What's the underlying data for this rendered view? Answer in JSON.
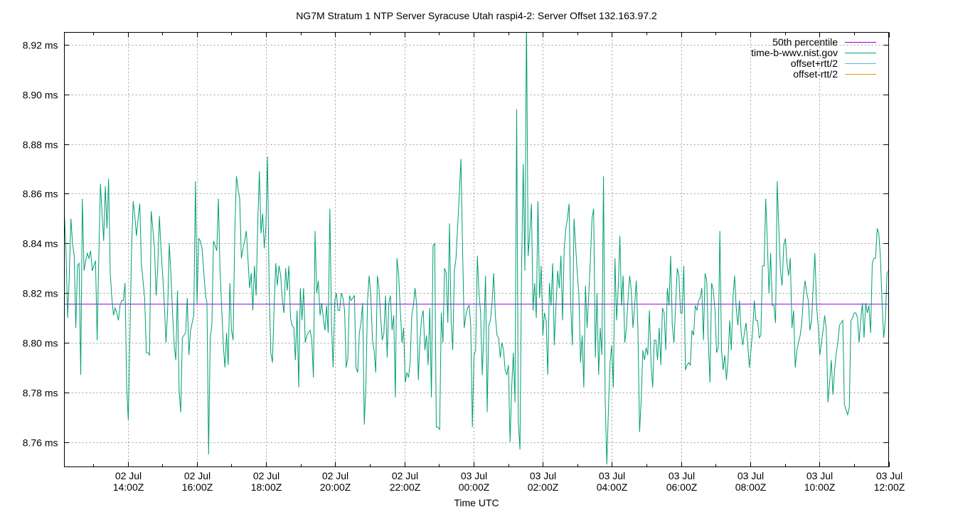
{
  "chart_data": {
    "type": "line",
    "title": "NG7M Stratum 1 NTP Server Syracuse Utah raspi4-2: Server Offset 132.163.97.2",
    "xlabel": "Time UTC",
    "ylabel": "",
    "ylim": [
      8.75,
      8.925
    ],
    "yticks": [
      {
        "value": 8.76,
        "label": "8.76 ms"
      },
      {
        "value": 8.78,
        "label": "8.78 ms"
      },
      {
        "value": 8.8,
        "label": "8.80 ms"
      },
      {
        "value": 8.82,
        "label": "8.82 ms"
      },
      {
        "value": 8.84,
        "label": "8.84 ms"
      },
      {
        "value": 8.86,
        "label": "8.86 ms"
      },
      {
        "value": 8.88,
        "label": "8.88 ms"
      },
      {
        "value": 8.9,
        "label": "8.90 ms"
      },
      {
        "value": 8.92,
        "label": "8.92 ms"
      }
    ],
    "xlim_hours": [
      12.17,
      36.0
    ],
    "xticks": [
      {
        "hours": 14,
        "line1": "02 Jul",
        "line2": "14:00Z"
      },
      {
        "hours": 16,
        "line1": "02 Jul",
        "line2": "16:00Z"
      },
      {
        "hours": 18,
        "line1": "02 Jul",
        "line2": "18:00Z"
      },
      {
        "hours": 20,
        "line1": "02 Jul",
        "line2": "20:00Z"
      },
      {
        "hours": 22,
        "line1": "02 Jul",
        "line2": "22:00Z"
      },
      {
        "hours": 24,
        "line1": "03 Jul",
        "line2": "00:00Z"
      },
      {
        "hours": 26,
        "line1": "03 Jul",
        "line2": "02:00Z"
      },
      {
        "hours": 28,
        "line1": "03 Jul",
        "line2": "04:00Z"
      },
      {
        "hours": 30,
        "line1": "03 Jul",
        "line2": "06:00Z"
      },
      {
        "hours": 32,
        "line1": "03 Jul",
        "line2": "08:00Z"
      },
      {
        "hours": 34,
        "line1": "03 Jul",
        "line2": "10:00Z"
      },
      {
        "hours": 36,
        "line1": "03 Jul",
        "line2": "12:00Z"
      }
    ],
    "grid": true,
    "legend_position": "top-right",
    "series": [
      {
        "name": "50th percentile",
        "color": "#9400d3",
        "kind": "hline",
        "value": 8.8155
      },
      {
        "name": "time-b-wwv.nist.gov",
        "color": "#009e73",
        "kind": "line",
        "values": [
          8.852,
          8.837,
          8.81,
          8.827,
          8.85,
          8.84,
          8.835,
          8.806,
          8.831,
          8.832,
          8.787,
          8.858,
          8.829,
          8.833,
          8.836,
          8.834,
          8.837,
          8.829,
          8.831,
          8.833,
          8.801,
          8.834,
          8.864,
          8.852,
          8.841,
          8.863,
          8.846,
          8.866,
          8.828,
          8.818,
          8.811,
          8.814,
          8.812,
          8.809,
          8.815,
          8.817,
          8.817,
          8.824,
          8.782,
          8.769,
          8.803,
          8.838,
          8.857,
          8.851,
          8.843,
          8.85,
          8.856,
          8.832,
          8.825,
          8.818,
          8.796,
          8.796,
          8.795,
          8.853,
          8.846,
          8.838,
          8.819,
          8.83,
          8.851,
          8.838,
          8.827,
          8.815,
          8.8,
          8.813,
          8.84,
          8.828,
          8.812,
          8.799,
          8.793,
          8.821,
          8.781,
          8.772,
          8.802,
          8.803,
          8.804,
          8.818,
          8.795,
          8.805,
          8.808,
          8.811,
          8.865,
          8.816,
          8.842,
          8.841,
          8.838,
          8.829,
          8.82,
          8.816,
          8.755,
          8.802,
          8.807,
          8.841,
          8.839,
          8.837,
          8.858,
          8.829,
          8.814,
          8.799,
          8.79,
          8.804,
          8.791,
          8.824,
          8.805,
          8.801,
          8.844,
          8.867,
          8.862,
          8.858,
          8.834,
          8.838,
          8.841,
          8.845,
          8.834,
          8.822,
          8.828,
          8.813,
          8.831,
          8.819,
          8.848,
          8.869,
          8.844,
          8.852,
          8.838,
          8.847,
          8.875,
          8.821,
          8.796,
          8.792,
          8.814,
          8.832,
          8.823,
          8.831,
          8.827,
          8.817,
          8.812,
          8.83,
          8.821,
          8.831,
          8.81,
          8.807,
          8.806,
          8.793,
          8.813,
          8.782,
          8.822,
          8.809,
          8.822,
          8.8,
          8.803,
          8.804,
          8.805,
          8.801,
          8.786,
          8.845,
          8.82,
          8.825,
          8.811,
          8.816,
          8.81,
          8.805,
          8.815,
          8.804,
          8.854,
          8.808,
          8.79,
          8.817,
          8.82,
          8.813,
          8.813,
          8.82,
          8.818,
          8.813,
          8.79,
          8.794,
          8.819,
          8.817,
          8.818,
          8.819,
          8.79,
          8.788,
          8.804,
          8.808,
          8.816,
          8.767,
          8.783,
          8.817,
          8.827,
          8.819,
          8.801,
          8.797,
          8.788,
          8.827,
          8.822,
          8.81,
          8.801,
          8.804,
          8.819,
          8.794,
          8.816,
          8.819,
          8.805,
          8.811,
          8.778,
          8.834,
          8.827,
          8.813,
          8.8,
          8.806,
          8.784,
          8.788,
          8.786,
          8.792,
          8.811,
          8.815,
          8.822,
          8.815,
          8.785,
          8.801,
          8.81,
          8.813,
          8.797,
          8.803,
          8.791,
          8.814,
          8.778,
          8.839,
          8.84,
          8.766,
          8.766,
          8.765,
          8.812,
          8.8,
          8.83,
          8.828,
          8.808,
          8.848,
          8.809,
          8.797,
          8.829,
          8.834,
          8.847,
          8.86,
          8.874,
          8.838,
          8.806,
          8.811,
          8.814,
          8.815,
          8.807,
          8.766,
          8.795,
          8.797,
          8.835,
          8.82,
          8.812,
          8.787,
          8.805,
          8.827,
          8.772,
          8.807,
          8.809,
          8.816,
          8.828,
          8.811,
          8.803,
          8.802,
          8.794,
          8.8,
          8.797,
          8.789,
          8.787,
          8.791,
          8.76,
          8.782,
          8.796,
          8.776,
          8.894,
          8.768,
          8.757,
          8.83,
          8.872,
          8.829,
          8.931,
          8.835,
          8.844,
          8.856,
          8.813,
          8.824,
          8.81,
          8.857,
          8.818,
          8.831,
          8.803,
          8.812,
          8.809,
          8.787,
          8.824,
          8.815,
          8.832,
          8.799,
          8.815,
          8.829,
          8.822,
          8.835,
          8.809,
          8.838,
          8.846,
          8.85,
          8.856,
          8.815,
          8.799,
          8.85,
          8.839,
          8.828,
          8.819,
          8.792,
          8.803,
          8.782,
          8.823,
          8.806,
          8.819,
          8.833,
          8.85,
          8.854,
          8.794,
          8.82,
          8.787,
          8.806,
          8.795,
          8.867,
          8.777,
          8.751,
          8.773,
          8.792,
          8.799,
          8.782,
          8.834,
          8.809,
          8.822,
          8.843,
          8.815,
          8.827,
          8.8,
          8.806,
          8.818,
          8.827,
          8.821,
          8.806,
          8.815,
          8.825,
          8.805,
          8.764,
          8.777,
          8.797,
          8.793,
          8.798,
          8.795,
          8.813,
          8.792,
          8.782,
          8.801,
          8.801,
          8.793,
          8.806,
          8.791,
          8.814,
          8.812,
          8.797,
          8.822,
          8.815,
          8.835,
          8.807,
          8.8,
          8.815,
          8.83,
          8.827,
          8.812,
          8.812,
          8.831,
          8.789,
          8.791,
          8.792,
          8.791,
          8.805,
          8.803,
          8.815,
          8.813,
          8.817,
          8.818,
          8.822,
          8.801,
          8.828,
          8.825,
          8.8,
          8.784,
          8.824,
          8.821,
          8.813,
          8.796,
          8.798,
          8.845,
          8.797,
          8.789,
          8.795,
          8.785,
          8.793,
          8.809,
          8.797,
          8.818,
          8.827,
          8.814,
          8.807,
          8.817,
          8.804,
          8.799,
          8.804,
          8.808,
          8.8,
          8.79,
          8.797,
          8.805,
          8.817,
          8.809,
          8.809,
          8.802,
          8.803,
          8.831,
          8.831,
          8.858,
          8.84,
          8.82,
          8.836,
          8.815,
          8.815,
          8.808,
          8.865,
          8.846,
          8.829,
          8.823,
          8.839,
          8.842,
          8.832,
          8.827,
          8.834,
          8.806,
          8.813,
          8.79,
          8.797,
          8.8,
          8.803,
          8.808,
          8.819,
          8.825,
          8.82,
          8.817,
          8.805,
          8.809,
          8.823,
          8.836,
          8.815,
          8.807,
          8.795,
          8.8,
          8.805,
          8.811,
          8.805,
          8.776,
          8.784,
          8.793,
          8.779,
          8.789,
          8.796,
          8.8,
          8.807,
          8.808,
          8.809,
          8.775,
          8.773,
          8.771,
          8.774,
          8.809,
          8.81,
          8.812,
          8.812,
          8.81,
          8.8,
          8.809,
          8.816,
          8.802,
          8.816,
          8.812,
          8.815,
          8.804,
          8.832,
          8.834,
          8.834,
          8.846,
          8.844,
          8.834,
          8.816,
          8.802,
          8.809,
          8.828,
          8.829
        ]
      },
      {
        "name": "offset+rtt/2",
        "color": "#56b4e9",
        "kind": "legend-only"
      },
      {
        "name": "offset-rtt/2",
        "color": "#e69f00",
        "kind": "legend-only"
      }
    ]
  }
}
